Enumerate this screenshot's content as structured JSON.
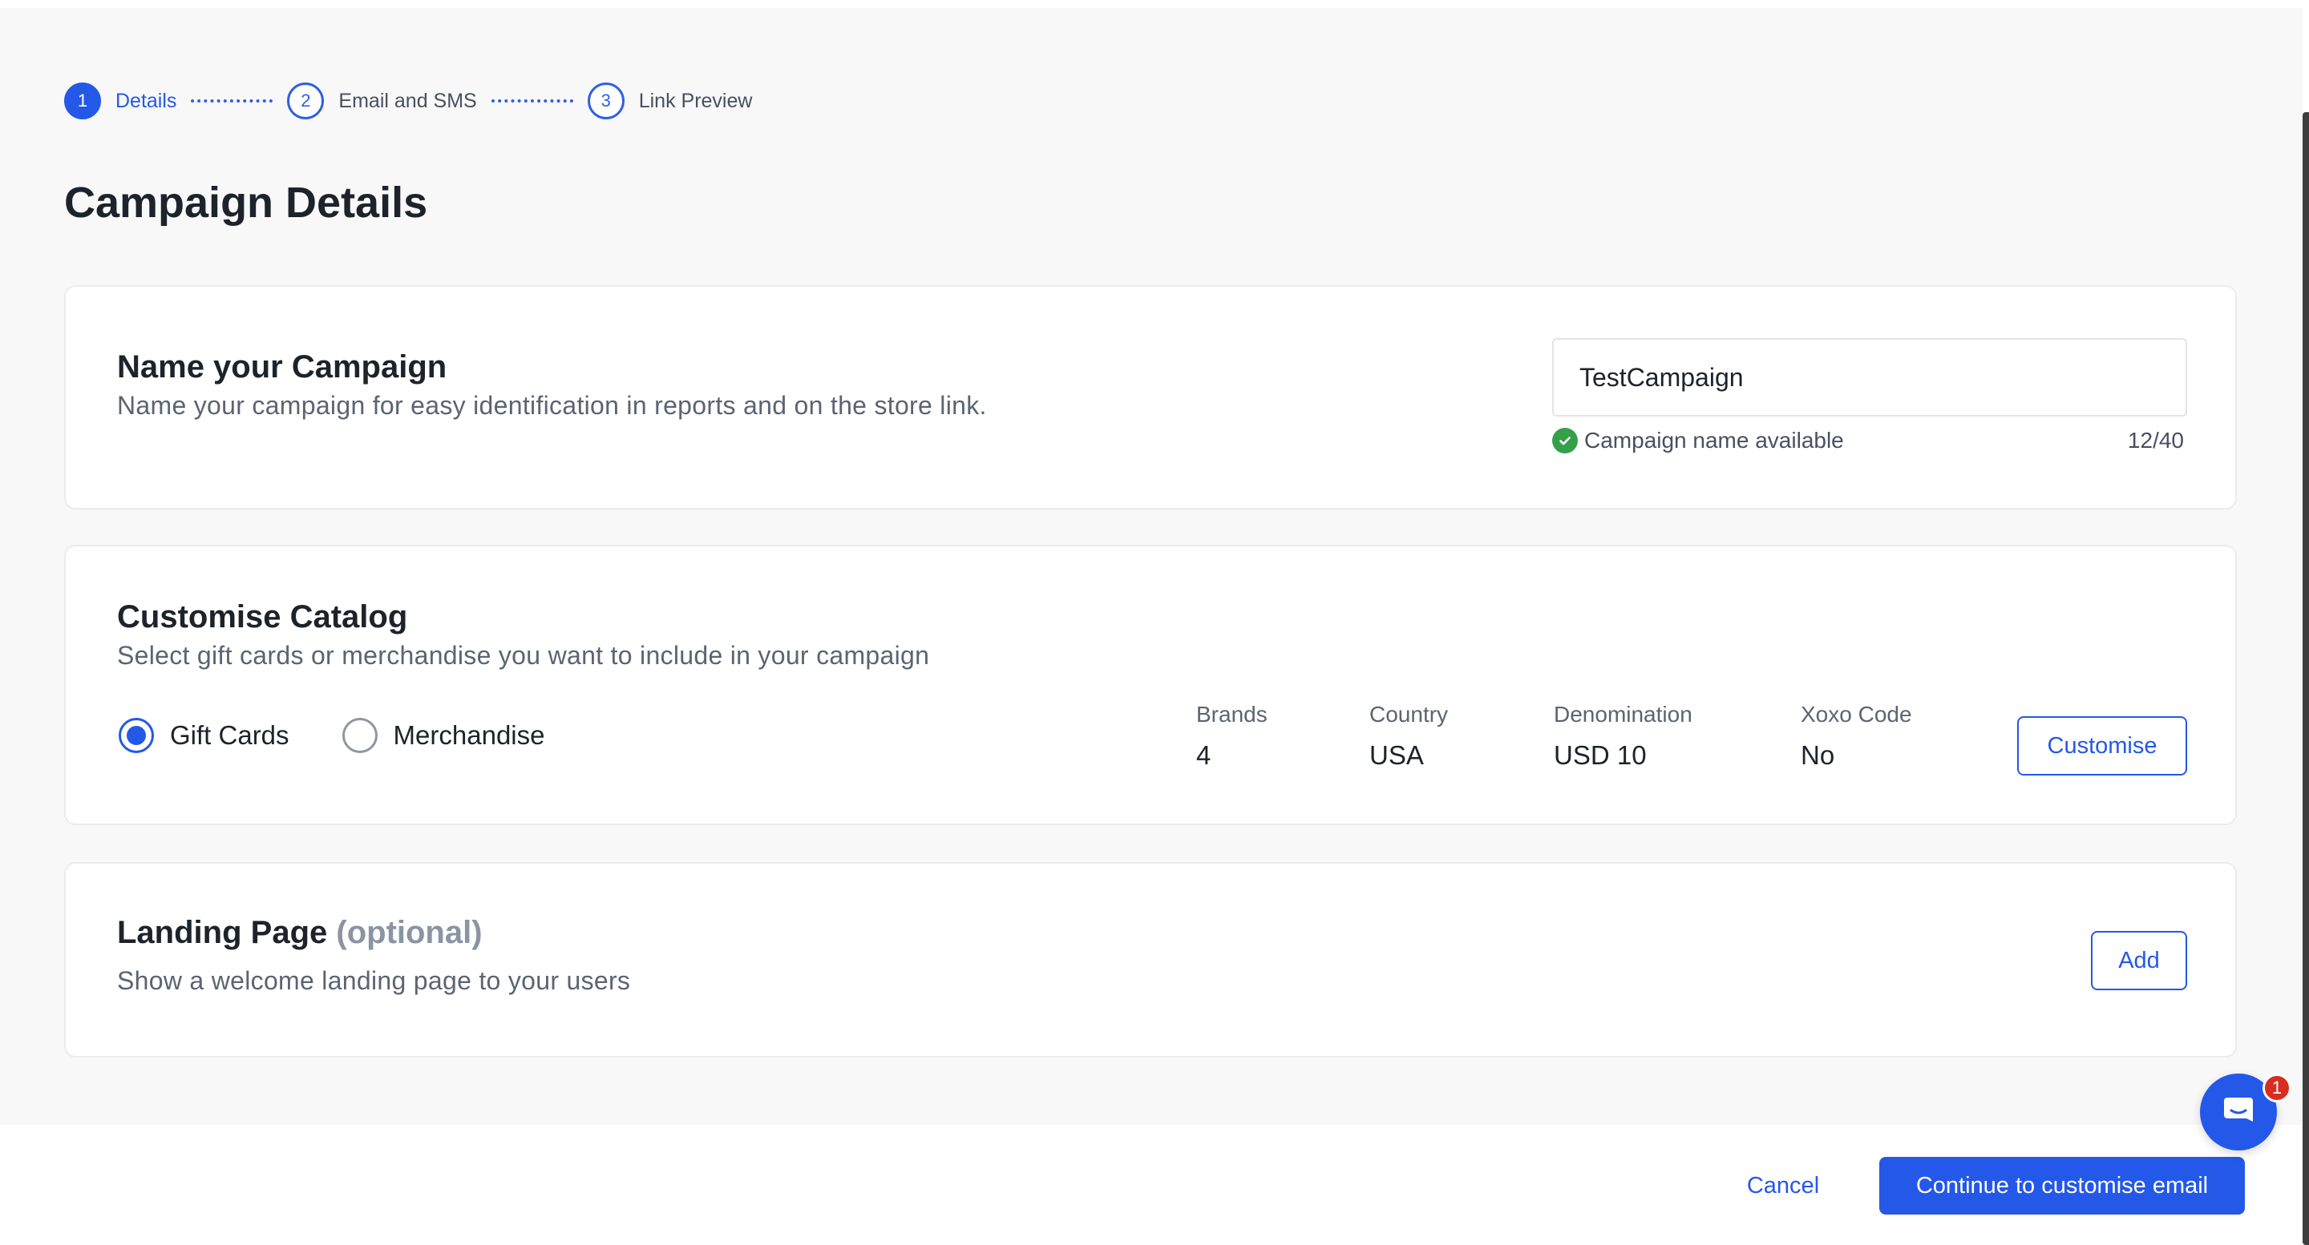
{
  "stepper": {
    "steps": [
      {
        "number": "1",
        "label": "Details"
      },
      {
        "number": "2",
        "label": "Email and SMS"
      },
      {
        "number": "3",
        "label": "Link Preview"
      }
    ]
  },
  "page_title": "Campaign Details",
  "name_card": {
    "title": "Name your Campaign",
    "subtitle": "Name your campaign for easy identification in reports and on the store link.",
    "input_value": "TestCampaign",
    "status": "Campaign name available",
    "char_count": "12/40"
  },
  "catalog_card": {
    "title": "Customise Catalog",
    "subtitle": "Select gift cards or merchandise you want to include in your campaign",
    "options": [
      {
        "label": "Gift Cards",
        "checked": true
      },
      {
        "label": "Merchandise",
        "checked": false
      }
    ],
    "stats": [
      {
        "label": "Brands",
        "value": "4"
      },
      {
        "label": "Country",
        "value": "USA"
      },
      {
        "label": "Denomination",
        "value": "USD 10"
      },
      {
        "label": "Xoxo Code",
        "value": "No"
      }
    ],
    "customise_label": "Customise"
  },
  "landing_card": {
    "title": "Landing Page",
    "optional": "(optional)",
    "subtitle": "Show a welcome landing page to your users",
    "add_label": "Add"
  },
  "footer": {
    "cancel_label": "Cancel",
    "continue_label": "Continue to customise email"
  },
  "chat": {
    "badge_count": "1",
    "icon": "chat-icon"
  },
  "colors": {
    "accent": "#2458e8",
    "success": "#34a049",
    "badge": "#d92d20"
  }
}
